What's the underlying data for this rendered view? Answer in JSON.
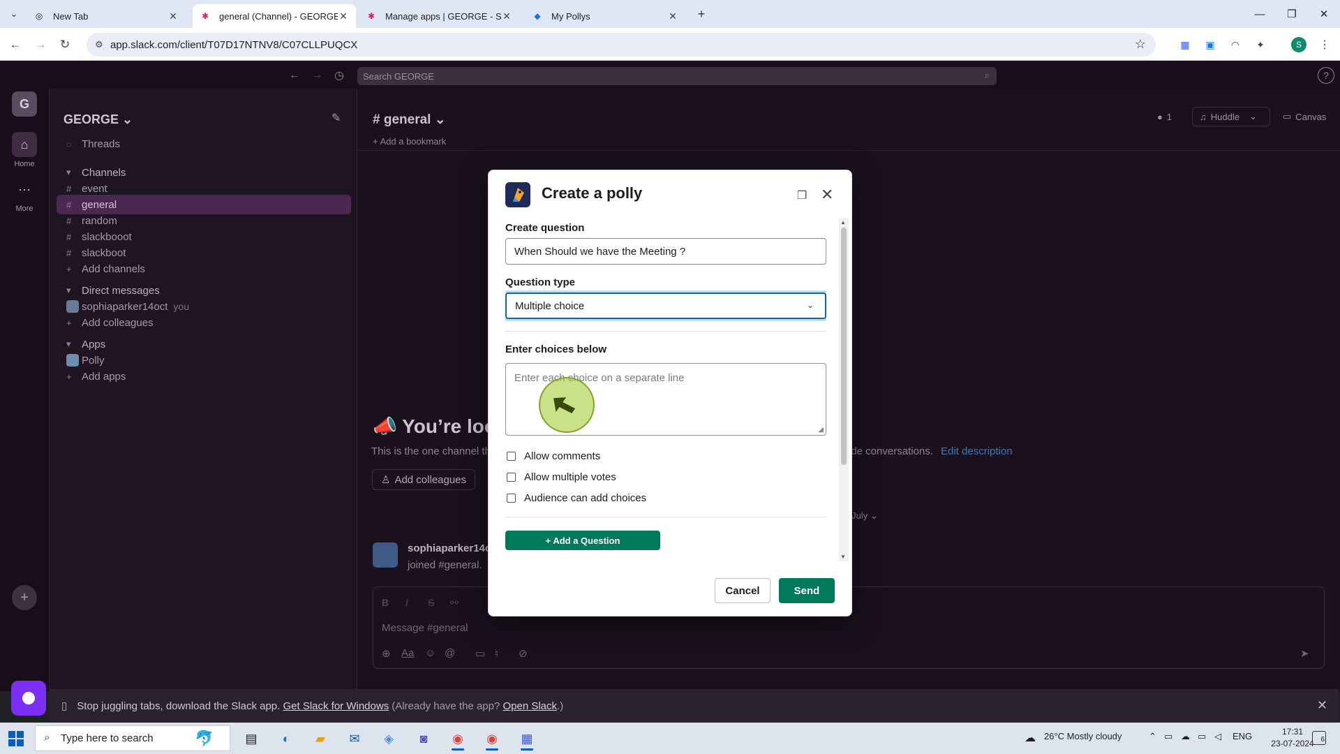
{
  "browser": {
    "tabs": [
      {
        "title": "New Tab",
        "icon": "chrome-icon"
      },
      {
        "title": "general (Channel) - GEORGE - S",
        "icon": "slack-icon"
      },
      {
        "title": "Manage apps | GEORGE - Slack",
        "icon": "slack-icon"
      },
      {
        "title": "My Pollys",
        "icon": "polly-icon"
      }
    ],
    "url": "app.slack.com/client/T07D17NTNV8/C07CLLPUQCX",
    "profile_initial": "S"
  },
  "slack": {
    "search_placeholder": "Search GEORGE",
    "rail": {
      "workspace_initial": "G",
      "home_label": "Home",
      "more_label": "More"
    },
    "sidebar": {
      "workspace_name": "GEORGE",
      "threads_label": "Threads",
      "channels_section": "Channels",
      "channels": [
        "event",
        "general",
        "random",
        "slackbooot",
        "slackboot"
      ],
      "add_channels": "Add channels",
      "dm_section": "Direct messages",
      "dm_user": "sophiaparker14oct",
      "dm_you": "you",
      "add_colleagues": "Add colleagues",
      "apps_section": "Apps",
      "apps": [
        "Polly"
      ],
      "add_apps": "Add apps"
    },
    "channel": {
      "name": "# general",
      "add_bookmark": "Add a bookmark",
      "member_count": "1",
      "huddle_label": "Huddle",
      "canvas_label": "Canvas",
      "welcome_title": "You’re loo",
      "welcome_sub": "This is the one channel th",
      "welcome_sub_tail": "ide conversations.",
      "edit_description": "Edit description",
      "add_colleagues_btn": "Add colleagues",
      "date_label": "18 July",
      "message_author": "sophiaparker14oc",
      "message_text": "joined #general.",
      "composer_placeholder": "Message #general"
    },
    "download_banner": {
      "text": "Stop juggling tabs, download the Slack app.",
      "link1": "Get Slack for Windows",
      "middle": "(Already have the app?",
      "link2": "Open Slack",
      "end": ".)"
    }
  },
  "modal": {
    "title": "Create a polly",
    "create_question_label": "Create question",
    "question_value": "When Should we have the Meeting ?",
    "question_type_label": "Question type",
    "question_type_value": "Multiple choice",
    "choices_label": "Enter choices below",
    "choices_placeholder": "Enter each choice on a separate line",
    "checkboxes": [
      {
        "label": "Allow comments",
        "checked": false
      },
      {
        "label": "Allow multiple votes",
        "checked": false
      },
      {
        "label": "Audience can add choices",
        "checked": false
      }
    ],
    "add_question_label": "+ Add a Question",
    "cancel_label": "Cancel",
    "send_label": "Send"
  },
  "taskbar": {
    "search_placeholder": "Type here to search",
    "weather": "26°C  Mostly cloudy",
    "language": "ENG",
    "time": "17:31",
    "date": "23-07-2024",
    "notification_count": "6"
  }
}
